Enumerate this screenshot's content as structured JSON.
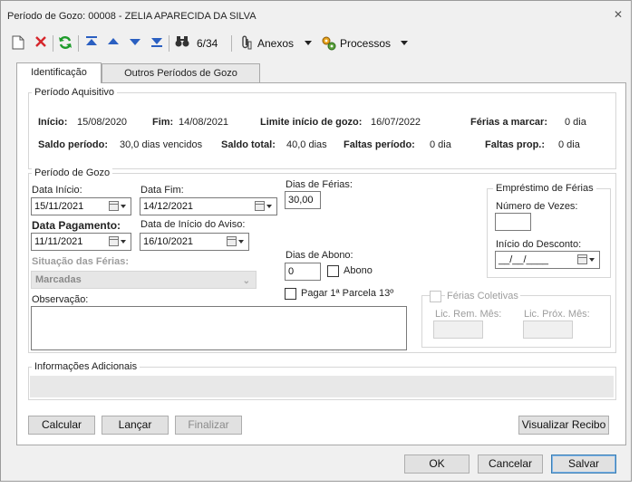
{
  "window": {
    "title": "Período de Gozo: 00008 - ZELIA APARECIDA DA SILVA",
    "close_glyph": "✕"
  },
  "toolbar": {
    "record_counter": "6/34",
    "anexos_label": "Anexos",
    "processos_label": "Processos"
  },
  "tabs": [
    {
      "label": "Identificação"
    },
    {
      "label": "Outros Períodos de Gozo"
    }
  ],
  "periodo_aquisitivo": {
    "title": "Período Aquisitivo",
    "inicio_label": "Início:",
    "inicio_value": "15/08/2020",
    "fim_label": "Fim:",
    "fim_value": "14/08/2021",
    "limite_label": "Limite início de gozo:",
    "limite_value": "16/07/2022",
    "ferias_marcar_label": "Férias a marcar:",
    "ferias_marcar_value": "0 dia",
    "saldo_periodo_label": "Saldo período:",
    "saldo_periodo_value": "30,0 dias vencidos",
    "saldo_total_label": "Saldo total:",
    "saldo_total_value": "40,0  dias",
    "faltas_periodo_label": "Faltas período:",
    "faltas_periodo_value": "0  dia",
    "faltas_prop_label": "Faltas prop.:",
    "faltas_prop_value": "0  dia"
  },
  "periodo_gozo": {
    "title": "Período de Gozo",
    "data_inicio_label": "Data Início:",
    "data_inicio_value": "15/11/2021",
    "data_fim_label": "Data Fim:",
    "data_fim_value": "14/12/2021",
    "data_pagamento_label": "Data Pagamento:",
    "data_pagamento_value": "11/11/2021",
    "data_aviso_label": "Data de Início do Aviso:",
    "data_aviso_value": "16/10/2021",
    "situacao_label": "Situação das Férias:",
    "situacao_value": "Marcadas",
    "observacao_label": "Observação:",
    "observacao_value": "",
    "dias_ferias_label": "Dias de Férias:",
    "dias_ferias_value": "30,00",
    "dias_abono_label": "Dias de Abono:",
    "dias_abono_value": "0",
    "abono_label": "Abono",
    "pagar_parcela_label": "Pagar 1ª Parcela 13º"
  },
  "emprestimo": {
    "title": "Empréstimo de Férias",
    "num_vezes_label": "Número de Vezes:",
    "num_vezes_value": "",
    "inicio_desconto_label": "Início do Desconto:",
    "inicio_desconto_value": "__/__/____"
  },
  "ferias_coletivas": {
    "label": "Férias Coletivas",
    "lic_rem_label": "Lic. Rem. Mês:",
    "lic_prox_label": "Lic. Próx. Mês:"
  },
  "info_adicionais": {
    "title": "Informações Adicionais"
  },
  "buttons": {
    "calcular": "Calcular",
    "lancar": "Lançar",
    "finalizar": "Finalizar",
    "visualizar_recibo": "Visualizar Recibo",
    "ok": "OK",
    "cancelar": "Cancelar",
    "salvar": "Salvar"
  },
  "colors": {
    "refresh_green": "#1e9b2b",
    "delete_red": "#d6262b",
    "nav_blue": "#2a5fc1",
    "default_button_border": "#3c7fb1"
  }
}
